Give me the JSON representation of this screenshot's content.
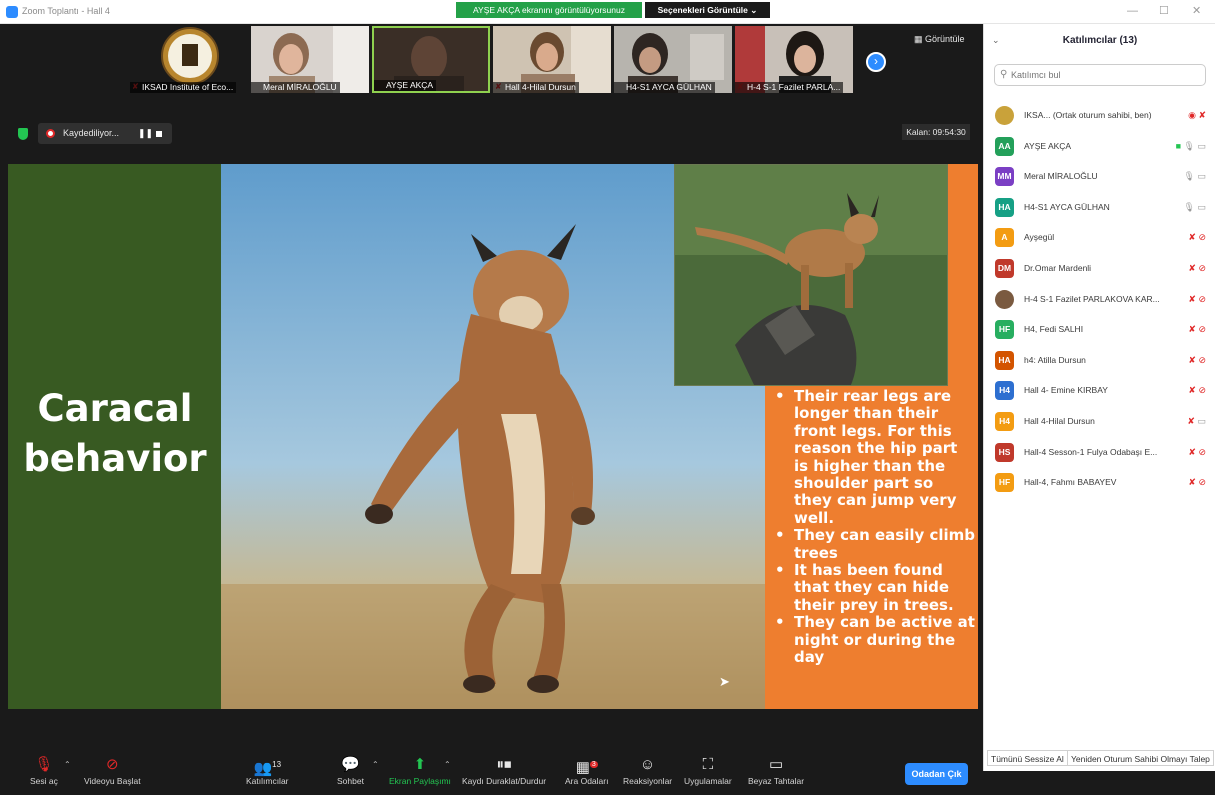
{
  "titlebar": {
    "app_title": "Zoom Toplantı - Hall 4",
    "share_status": "AYŞE AKÇA ekranını görüntülüyorsunuz",
    "view_options": "Seçenekleri Görüntüle ⌄",
    "minimize": "—",
    "maximize": "☐",
    "close": "✕"
  },
  "gallery": {
    "view_label": "Görüntüle",
    "next_icon": "chevron-right-icon",
    "thumbs": [
      {
        "name": "IKSAD Institute of Eco...",
        "muted": true
      },
      {
        "name": "Meral MİRALOĞLU",
        "muted": false
      },
      {
        "name": "AYŞE AKÇA",
        "muted": false
      },
      {
        "name": "Hall 4-Hilal Dursun",
        "muted": true
      },
      {
        "name": "H4-S1 AYCA GÜLHAN",
        "muted": false
      },
      {
        "name": "H-4 S-1 Fazilet PARLA...",
        "muted": true
      }
    ]
  },
  "recording": {
    "label": "Kaydediliyor...",
    "pause_glyph": "❚❚"
  },
  "timer": "Kalan: 09:54:30",
  "slide": {
    "title": "Caracal behavior",
    "bullets": [
      "Their rear legs are longer than their front legs. For this reason the hip part is higher than the shoulder part so they can jump very well.",
      "They can easily climb trees",
      "It has been found that they can hide their prey in trees.",
      "They can be active at night or during the day"
    ]
  },
  "toolbar": {
    "unmute": "Sesi aç",
    "start_video": "Videoyu Başlat",
    "participants": "Katılımcılar",
    "participants_count": "13",
    "chat": "Sohbet",
    "share_screen": "Ekran Paylaşımı",
    "pause_record": "Kaydı Duraklat/Durdur",
    "breakout": "Ara Odaları",
    "breakout_badge": "3",
    "reactions": "Reaksiyonlar",
    "apps": "Uygulamalar",
    "whiteboards": "Beyaz Tahtalar",
    "leave": "Odadan Çık"
  },
  "panel": {
    "title": "Katılımcılar (13)",
    "search_placeholder": "Katılımcı bul",
    "mute_all": "Tümünü Sessize Al",
    "reclaim_host": "Yeniden Oturum Sahibi Olmayı Talep",
    "participants": [
      {
        "initials": "",
        "name": "IKSA... (Ortak oturum sahibi, ben)",
        "color": "#c9a23a",
        "state": "self"
      },
      {
        "initials": "AA",
        "name": "AYŞE AKÇA",
        "color": "#23a05a",
        "state": "sharing"
      },
      {
        "initials": "MM",
        "name": "Meral MİRALOĞLU",
        "color": "#7b3fc4",
        "state": "unmuted"
      },
      {
        "initials": "HA",
        "name": "H4-S1 AYCA GÜLHAN",
        "color": "#16a085",
        "state": "unmuted"
      },
      {
        "initials": "A",
        "name": "Ayşegül",
        "color": "#f39c12",
        "state": "muted"
      },
      {
        "initials": "DM",
        "name": "Dr.Omar Mardenli",
        "color": "#c0392b",
        "state": "muted"
      },
      {
        "initials": "",
        "name": "H-4 S-1 Fazilet PARLAKOVA KAR...",
        "color": "#7a5a40",
        "state": "muted"
      },
      {
        "initials": "HF",
        "name": "H4, Fedi SALHI",
        "color": "#27ae60",
        "state": "muted"
      },
      {
        "initials": "HA",
        "name": "h4: Atilla Dursun",
        "color": "#d35400",
        "state": "muted"
      },
      {
        "initials": "H4",
        "name": "Hall 4- Emine KIRBAY",
        "color": "#2d6fd0",
        "state": "muted"
      },
      {
        "initials": "H4",
        "name": "Hall 4-Hilal Dursun",
        "color": "#f39c12",
        "state": "muted-cam"
      },
      {
        "initials": "HS",
        "name": "Hall-4 Sesson-1 Fulya Odabaşı E...",
        "color": "#c0392b",
        "state": "muted"
      },
      {
        "initials": "HF",
        "name": "Hall-4, Fahmı BABAYEV",
        "color": "#f39c12",
        "state": "muted"
      }
    ]
  }
}
